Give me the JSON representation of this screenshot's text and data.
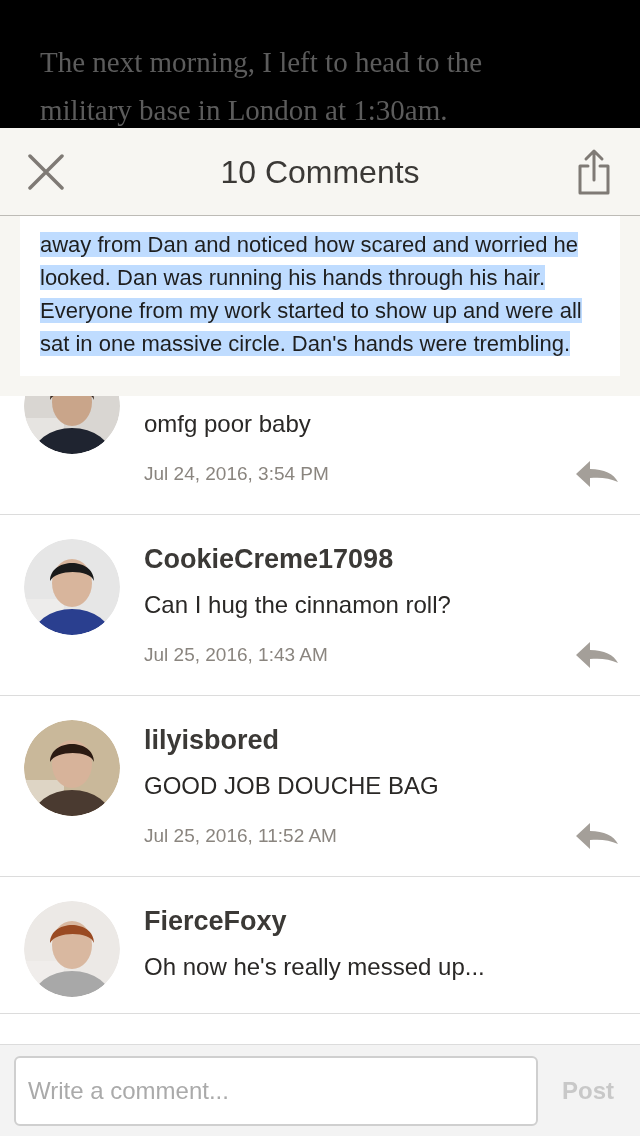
{
  "story": {
    "lines": [
      "The next morning, I left to head to the",
      "military base in London at 1:30am."
    ]
  },
  "header": {
    "title": "10 Comments"
  },
  "quote": {
    "text": "away from Dan and noticed how scared and worried he looked. Dan was running his hands through his hair. Everyone from my work started to show up and were all sat in one massive circle. Dan's hands were trembling.",
    "highlighted": true
  },
  "comments": [
    {
      "body": "omfg poor baby",
      "date": "Jul 24, 2016, 3:54 PM"
    },
    {
      "user": "CookieCreme17098",
      "body": "Can I hug the cinnamon roll?",
      "date": "Jul 25, 2016, 1:43 AM"
    },
    {
      "user": "lilyisbored",
      "body": "GOOD JOB DOUCHE BAG",
      "date": "Jul 25, 2016, 11:52 AM"
    },
    {
      "user": "FierceFoxy",
      "body": "Oh now he's really messed up..."
    }
  ],
  "composer": {
    "placeholder": "Write a comment...",
    "post": "Post",
    "post_disabled": true
  }
}
